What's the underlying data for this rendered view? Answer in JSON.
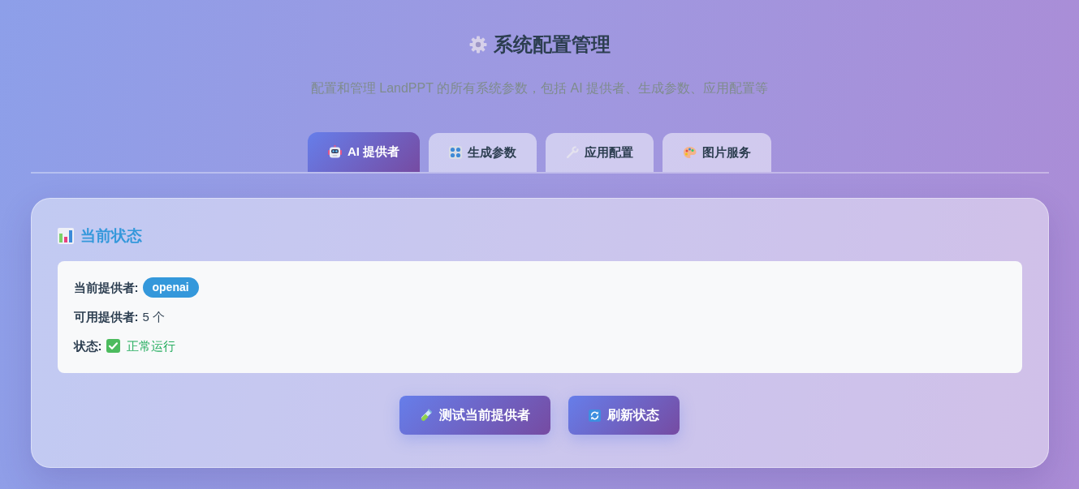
{
  "header": {
    "title": "系统配置管理",
    "subtitle": "配置和管理 LandPPT 的所有系统参数，包括 AI 提供者、生成参数、应用配置等"
  },
  "tabs": [
    {
      "label": "AI 提供者",
      "selected": true
    },
    {
      "label": "生成参数",
      "selected": false
    },
    {
      "label": "应用配置",
      "selected": false
    },
    {
      "label": "图片服务",
      "selected": false
    }
  ],
  "status_panel": {
    "title": "当前状态",
    "rows": [
      {
        "kind": "badge",
        "label": "当前提供者:",
        "value": "openai"
      },
      {
        "kind": "text",
        "label": "可用提供者:",
        "value": "5 个"
      },
      {
        "kind": "status",
        "label": "状态:",
        "value": "正常运行"
      }
    ]
  },
  "buttons": [
    "测试当前提供者",
    "刷新状态"
  ]
}
